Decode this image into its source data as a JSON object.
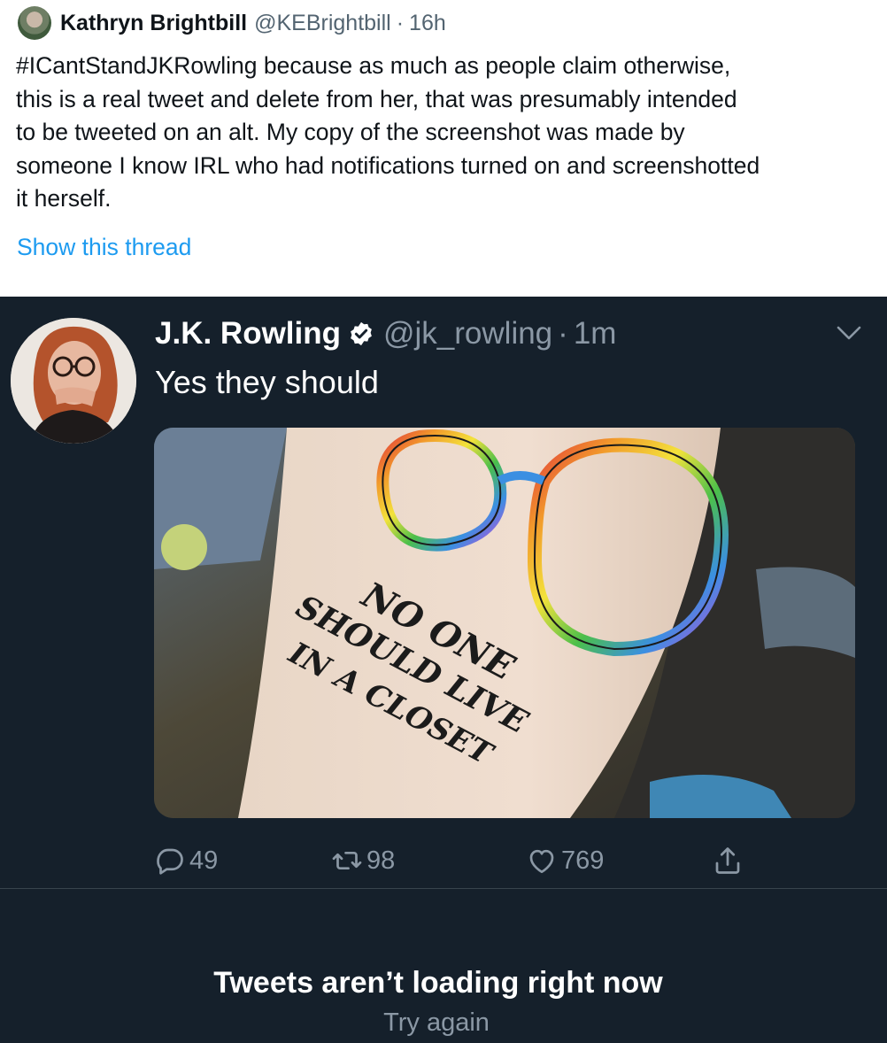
{
  "outer_tweet": {
    "author_name": "Kathryn Brightbill",
    "handle": "@KEBrightbill",
    "separator": "·",
    "time": "16h",
    "body_lines": [
      "#ICantStandJKRowling because as much as people claim otherwise,",
      "this is a real tweet and delete from her, that was presumably intended",
      "to be tweeted on an alt. My copy of the screenshot was made by",
      "someone I know IRL who had notifications turned on and screenshotted",
      "it herself."
    ],
    "show_thread": "Show this thread"
  },
  "embedded_tweet": {
    "author_name": "J.K. Rowling",
    "handle": "@jk_rowling",
    "separator": "·",
    "time": "1m",
    "text": "Yes they should",
    "tattoo_text": [
      "NO ONE",
      "SHOULD LIVE",
      "IN A CLOSET"
    ],
    "actions": {
      "replies": "49",
      "retweets": "98",
      "likes": "769"
    },
    "error_title": "Tweets aren’t loading right now",
    "retry_label": "Try again"
  },
  "colors": {
    "link_blue": "#1d9bf0",
    "dark_bg": "#15202b",
    "dark_secondary": "#8b98a5"
  },
  "icons": [
    "verified-badge-icon",
    "chevron-down-icon",
    "reply-icon",
    "retweet-icon",
    "like-icon",
    "share-icon"
  ]
}
